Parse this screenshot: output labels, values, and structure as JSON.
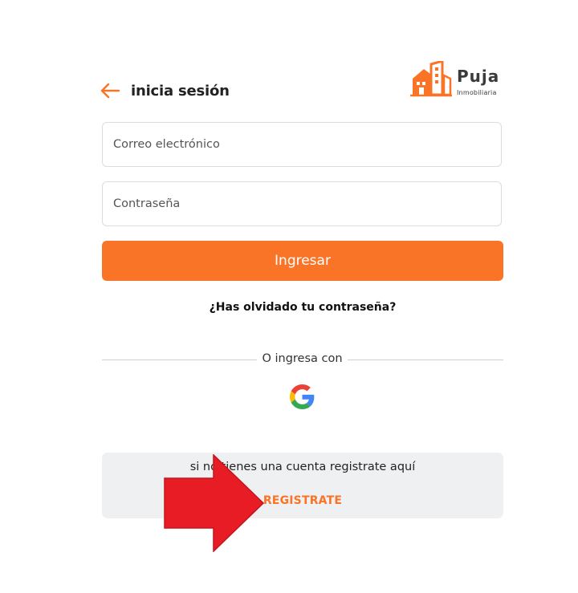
{
  "header": {
    "back_icon": "arrow-left-icon",
    "title": "inicia sesión"
  },
  "logo": {
    "name": "Puja",
    "subtitle": "Inmobiliaria",
    "icon": "buildings-logo-icon"
  },
  "form": {
    "email_placeholder": "Correo electrónico",
    "email_value": "",
    "password_placeholder": "Contraseña",
    "password_value": "",
    "login_label": "Ingresar",
    "forgot_label": "¿Has olvidado tu contraseña?"
  },
  "social": {
    "divider_text": "O ingresa con",
    "google_icon": "google-icon"
  },
  "register": {
    "text": "si no tienes una cuenta registrate aquí",
    "link_label": "REGISTRATE"
  },
  "colors": {
    "accent": "#f97427",
    "annotation_arrow": "#e81c24",
    "register_bg": "#eff0f2"
  }
}
